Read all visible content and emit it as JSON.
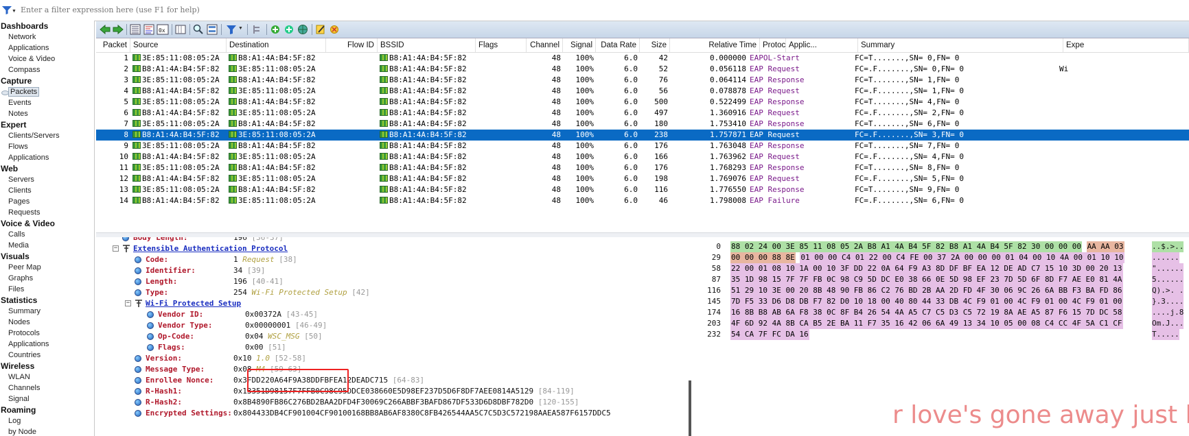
{
  "filter": {
    "placeholder": "Enter a filter expression here (use F1 for help)"
  },
  "sidebar": [
    {
      "label": "Dashboards",
      "type": "section"
    },
    {
      "label": "Network",
      "type": "item"
    },
    {
      "label": "Applications",
      "type": "item"
    },
    {
      "label": "Voice & Video",
      "type": "item"
    },
    {
      "label": "Compass",
      "type": "item"
    },
    {
      "label": "Capture",
      "type": "section"
    },
    {
      "label": "Packets",
      "type": "item",
      "selected": true
    },
    {
      "label": "Events",
      "type": "item"
    },
    {
      "label": "Notes",
      "type": "item"
    },
    {
      "label": "Expert",
      "type": "section"
    },
    {
      "label": "Clients/Servers",
      "type": "item"
    },
    {
      "label": "Flows",
      "type": "item"
    },
    {
      "label": "Applications",
      "type": "item"
    },
    {
      "label": "Web",
      "type": "section"
    },
    {
      "label": "Servers",
      "type": "item"
    },
    {
      "label": "Clients",
      "type": "item"
    },
    {
      "label": "Pages",
      "type": "item"
    },
    {
      "label": "Requests",
      "type": "item"
    },
    {
      "label": "Voice & Video",
      "type": "section"
    },
    {
      "label": "Calls",
      "type": "item"
    },
    {
      "label": "Media",
      "type": "item"
    },
    {
      "label": "Visuals",
      "type": "section"
    },
    {
      "label": "Peer Map",
      "type": "item"
    },
    {
      "label": "Graphs",
      "type": "item"
    },
    {
      "label": "Files",
      "type": "item"
    },
    {
      "label": "Statistics",
      "type": "section"
    },
    {
      "label": "Summary",
      "type": "item"
    },
    {
      "label": "Nodes",
      "type": "item"
    },
    {
      "label": "Protocols",
      "type": "item"
    },
    {
      "label": "Applications",
      "type": "item"
    },
    {
      "label": "Countries",
      "type": "item"
    },
    {
      "label": "Wireless",
      "type": "section"
    },
    {
      "label": "WLAN",
      "type": "item"
    },
    {
      "label": "Channels",
      "type": "item"
    },
    {
      "label": "Signal",
      "type": "item"
    },
    {
      "label": "Roaming",
      "type": "section"
    },
    {
      "label": "Log",
      "type": "item"
    },
    {
      "label": "by Node",
      "type": "item"
    }
  ],
  "columns": [
    "Packet",
    "Source",
    "Destination",
    "Flow ID",
    "BSSID",
    "Flags",
    "Channel",
    "Signal",
    "Data Rate",
    "Size",
    "Relative Time",
    "Protocol",
    "Applic...",
    "Summary",
    "Expe"
  ],
  "packets": [
    {
      "no": "1",
      "src": "3E:85:11:08:05:2A",
      "dst": "B8:A1:4A:B4:5F:82",
      "bssid": "B8:A1:4A:B4:5F:82",
      "ch": "48",
      "sig": "100%",
      "rate": "6.0",
      "size": "42",
      "time": "0.000000",
      "proto": "EAPOL-Start",
      "summary": "FC=T.......,SN=   0,FN= 0",
      "expert": ""
    },
    {
      "no": "2",
      "src": "B8:A1:4A:B4:5F:82",
      "dst": "3E:85:11:08:05:2A",
      "bssid": "B8:A1:4A:B4:5F:82",
      "ch": "48",
      "sig": "100%",
      "rate": "6.0",
      "size": "52",
      "time": "0.056118",
      "proto": "EAP Request",
      "summary": "FC=.F.......,SN=   0,FN= 0",
      "expert": "Wi"
    },
    {
      "no": "3",
      "src": "3E:85:11:08:05:2A",
      "dst": "B8:A1:4A:B4:5F:82",
      "bssid": "B8:A1:4A:B4:5F:82",
      "ch": "48",
      "sig": "100%",
      "rate": "6.0",
      "size": "76",
      "time": "0.064114",
      "proto": "EAP Response",
      "summary": "FC=T.......,SN=   1,FN= 0",
      "expert": ""
    },
    {
      "no": "4",
      "src": "B8:A1:4A:B4:5F:82",
      "dst": "3E:85:11:08:05:2A",
      "bssid": "B8:A1:4A:B4:5F:82",
      "ch": "48",
      "sig": "100%",
      "rate": "6.0",
      "size": "56",
      "time": "0.078878",
      "proto": "EAP Request",
      "summary": "FC=.F.......,SN=   1,FN= 0",
      "expert": ""
    },
    {
      "no": "5",
      "src": "3E:85:11:08:05:2A",
      "dst": "B8:A1:4A:B4:5F:82",
      "bssid": "B8:A1:4A:B4:5F:82",
      "ch": "48",
      "sig": "100%",
      "rate": "6.0",
      "size": "500",
      "time": "0.522499",
      "proto": "EAP Response",
      "summary": "FC=T.......,SN=   4,FN= 0",
      "expert": ""
    },
    {
      "no": "6",
      "src": "B8:A1:4A:B4:5F:82",
      "dst": "3E:85:11:08:05:2A",
      "bssid": "B8:A1:4A:B4:5F:82",
      "ch": "48",
      "sig": "100%",
      "rate": "6.0",
      "size": "497",
      "time": "1.360916",
      "proto": "EAP Request",
      "summary": "FC=.F.......,SN=   2,FN= 0",
      "expert": ""
    },
    {
      "no": "7",
      "src": "3E:85:11:08:05:2A",
      "dst": "B8:A1:4A:B4:5F:82",
      "bssid": "B8:A1:4A:B4:5F:82",
      "ch": "48",
      "sig": "100%",
      "rate": "6.0",
      "size": "180",
      "time": "1.753410",
      "proto": "EAP Response",
      "summary": "FC=T.......,SN=   6,FN= 0",
      "expert": ""
    },
    {
      "no": "8",
      "src": "B8:A1:4A:B4:5F:82",
      "dst": "3E:85:11:08:05:2A",
      "bssid": "B8:A1:4A:B4:5F:82",
      "ch": "48",
      "sig": "100%",
      "rate": "6.0",
      "size": "238",
      "time": "1.757871",
      "proto": "EAP Request",
      "summary": "FC=.F.......,SN=   3,FN= 0",
      "expert": "",
      "selected": true
    },
    {
      "no": "9",
      "src": "3E:85:11:08:05:2A",
      "dst": "B8:A1:4A:B4:5F:82",
      "bssid": "B8:A1:4A:B4:5F:82",
      "ch": "48",
      "sig": "100%",
      "rate": "6.0",
      "size": "176",
      "time": "1.763048",
      "proto": "EAP Response",
      "summary": "FC=T.......,SN=   7,FN= 0",
      "expert": ""
    },
    {
      "no": "10",
      "src": "B8:A1:4A:B4:5F:82",
      "dst": "3E:85:11:08:05:2A",
      "bssid": "B8:A1:4A:B4:5F:82",
      "ch": "48",
      "sig": "100%",
      "rate": "6.0",
      "size": "166",
      "time": "1.763962",
      "proto": "EAP Request",
      "summary": "FC=.F.......,SN=   4,FN= 0",
      "expert": ""
    },
    {
      "no": "11",
      "src": "3E:85:11:08:05:2A",
      "dst": "B8:A1:4A:B4:5F:82",
      "bssid": "B8:A1:4A:B4:5F:82",
      "ch": "48",
      "sig": "100%",
      "rate": "6.0",
      "size": "176",
      "time": "1.768293",
      "proto": "EAP Response",
      "summary": "FC=T.......,SN=   8,FN= 0",
      "expert": ""
    },
    {
      "no": "12",
      "src": "B8:A1:4A:B4:5F:82",
      "dst": "3E:85:11:08:05:2A",
      "bssid": "B8:A1:4A:B4:5F:82",
      "ch": "48",
      "sig": "100%",
      "rate": "6.0",
      "size": "198",
      "time": "1.769076",
      "proto": "EAP Request",
      "summary": "FC=.F.......,SN=   5,FN= 0",
      "expert": ""
    },
    {
      "no": "13",
      "src": "3E:85:11:08:05:2A",
      "dst": "B8:A1:4A:B4:5F:82",
      "bssid": "B8:A1:4A:B4:5F:82",
      "ch": "48",
      "sig": "100%",
      "rate": "6.0",
      "size": "116",
      "time": "1.776550",
      "proto": "EAP Response",
      "summary": "FC=T.......,SN=   9,FN= 0",
      "expert": ""
    },
    {
      "no": "14",
      "src": "B8:A1:4A:B4:5F:82",
      "dst": "3E:85:11:08:05:2A",
      "bssid": "B8:A1:4A:B4:5F:82",
      "ch": "48",
      "sig": "100%",
      "rate": "6.0",
      "size": "46",
      "time": "1.798008",
      "proto": "EAP Failure",
      "summary": "FC=.F.......,SN=   6,FN= 0",
      "expert": ""
    }
  ],
  "details": [
    {
      "indent": 0,
      "icon": "globe",
      "key": "Body Length:",
      "value": "196",
      "gray": "[36-37]"
    },
    {
      "indent": 0,
      "icon": "header",
      "toggle": "⊟",
      "header": "Extensible Authentication Protocol"
    },
    {
      "indent": 1,
      "icon": "globe",
      "key": "Code:",
      "value": "1",
      "orange": "Request",
      "gray": "[38]"
    },
    {
      "indent": 1,
      "icon": "globe",
      "key": "Identifier:",
      "value": "34",
      "gray": "[39]"
    },
    {
      "indent": 1,
      "icon": "globe",
      "key": "Length:",
      "value": "196",
      "gray": "[40-41]"
    },
    {
      "indent": 1,
      "icon": "globe",
      "key": "Type:",
      "value": "254",
      "orange": "Wi-Fi Protected Setup",
      "gray": "[42]"
    },
    {
      "indent": 1,
      "icon": "header",
      "toggle": "⊟",
      "header": "Wi-Fi Protected Setup"
    },
    {
      "indent": 2,
      "icon": "globe",
      "key": "Vendor ID:",
      "value": "0x00372A",
      "gray": "[43-45]"
    },
    {
      "indent": 2,
      "icon": "globe",
      "key": "Vendor Type:",
      "value": "0x00000001",
      "gray": "[46-49]"
    },
    {
      "indent": 2,
      "icon": "globe",
      "key": "Op-Code:",
      "value": "0x04",
      "orange": "WSC_MSG",
      "gray": "[50]"
    },
    {
      "indent": 2,
      "icon": "globe",
      "key": "Flags:",
      "value": "0x00",
      "gray": "[51]"
    },
    {
      "indent": 1,
      "icon": "globe",
      "key": "Version:",
      "value": "0x10",
      "orange": "1.0",
      "gray": "[52-58]"
    },
    {
      "indent": 1,
      "icon": "globe",
      "key": "Message Type:",
      "value": "0x08",
      "orange": "M4",
      "gray": "[59-63]"
    },
    {
      "indent": 1,
      "icon": "globe",
      "key": "Enrollee Nonce:",
      "value": "0x3FDD220A64F9A38DDFBFEA12DEADC715",
      "gray": "[64-83]"
    },
    {
      "indent": 1,
      "icon": "globe",
      "key": "R-Hash1:",
      "value": "0x13351D98157F7FFB0C98C95DDCE038660E5D98EF237D5D6F8DF7AEE0814A5129",
      "gray": "[84-119]"
    },
    {
      "indent": 1,
      "icon": "globe",
      "key": "R-Hash2:",
      "value": "0x8B4890FB86C276BD2BAA2DFD4F30069C266ABBF3BAFD867DF533D6D8DBF782D0",
      "gray": "[120-155]"
    },
    {
      "indent": 1,
      "icon": "globe",
      "key": "Encrypted Settings:",
      "value": "0x804433DB4CF901004CF90100168BB8AB6AF8380C8FB426544AA5C7C5D3C572198AAEA587F6157DDC5",
      "gray": ""
    }
  ],
  "hex": [
    {
      "off": "0",
      "bytes": [
        [
          "g",
          "88 02 24 00 3E 85 11 08 05 2A B8 A1 4A B4 5F 82 B8 A1 4A B4 5F 82 30 00 00 00"
        ],
        [
          "r",
          "AA AA 03"
        ]
      ],
      "ascii": "..$.>.."
    },
    {
      "off": "29",
      "bytes": [
        [
          "r",
          "00 00 00 88 8E"
        ],
        [
          "p",
          "01 00 00 C4 01 22 00 C4 FE 00 37 2A 00 00 00 01 04 00 10 4A 00 01 10 10"
        ]
      ],
      "ascii": "......"
    },
    {
      "off": "58",
      "bytes": [
        [
          "p",
          "22 00 01 08 10 1A 00 10 3F DD 22 0A 64 F9 A3 8D DF BF EA 12 DE AD C7 15 10 3D 00 20 13"
        ]
      ],
      "ascii": "\"......"
    },
    {
      "off": "87",
      "bytes": [
        [
          "p",
          "35 1D 98 15 7F 7F FB 0C 98 C9 5D DC E0 38 66 0E 5D 98 EF 23 7D 5D 6F 8D F7 AE E0 81 4A"
        ]
      ],
      "ascii": "5......"
    },
    {
      "off": "116",
      "bytes": [
        [
          "p",
          "51 29 10 3E 00 20 8B 48 90 FB 86 C2 76 BD 2B AA 2D FD 4F 30 06 9C 26 6A BB F3 BA FD 86"
        ]
      ],
      "ascii": "Q).>. ."
    },
    {
      "off": "145",
      "bytes": [
        [
          "p",
          "7D F5 33 D6 D8 DB F7 82 D0 10 18 00 40 80 44 33 DB 4C F9 01 00 4C F9 01 00 4C F9 01 00"
        ]
      ],
      "ascii": "}.3...."
    },
    {
      "off": "174",
      "bytes": [
        [
          "p",
          "16 8B B8 AB 6A F8 38 0C 8F B4 26 54 4A A5 C7 C5 D3 C5 72 19 8A AE A5 87 F6 15 7D DC 58"
        ]
      ],
      "ascii": "....j.8"
    },
    {
      "off": "203",
      "bytes": [
        [
          "p",
          "4F 6D 92 4A 8B CA B5 2E BA 11 F7 35 16 42 06 6A 49 13 34 10 05 00 08 C4 CC 4F 5A C1 CF"
        ]
      ],
      "ascii": "Om.J..."
    },
    {
      "off": "232",
      "bytes": [
        [
          "p",
          "54 CA 7F FC DA 16"
        ]
      ],
      "ascii": "T....."
    }
  ],
  "overlay": {
    "lyric": "r love's gone away just lik"
  },
  "colors": {
    "selected_row": "#0A6AC4",
    "protocol": "#7A1A8A",
    "field_key": "#B0182B",
    "header_link": "#1A2EC0",
    "annotation_box": "#EE2222"
  }
}
